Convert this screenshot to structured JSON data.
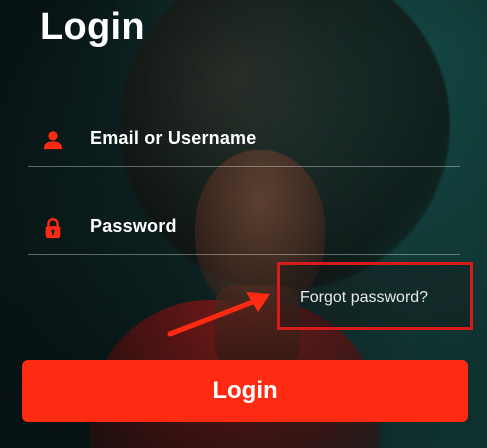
{
  "page": {
    "title": "Login"
  },
  "form": {
    "email": {
      "placeholder": "Email or Username",
      "icon": "user-icon"
    },
    "password": {
      "placeholder": "Password",
      "icon": "lock-icon"
    },
    "forgot_password": "Forgot password?",
    "submit_label": "Login"
  },
  "colors": {
    "accent": "#ff2a12",
    "highlight_box": "#d51b1b",
    "text": "#ffffff"
  }
}
